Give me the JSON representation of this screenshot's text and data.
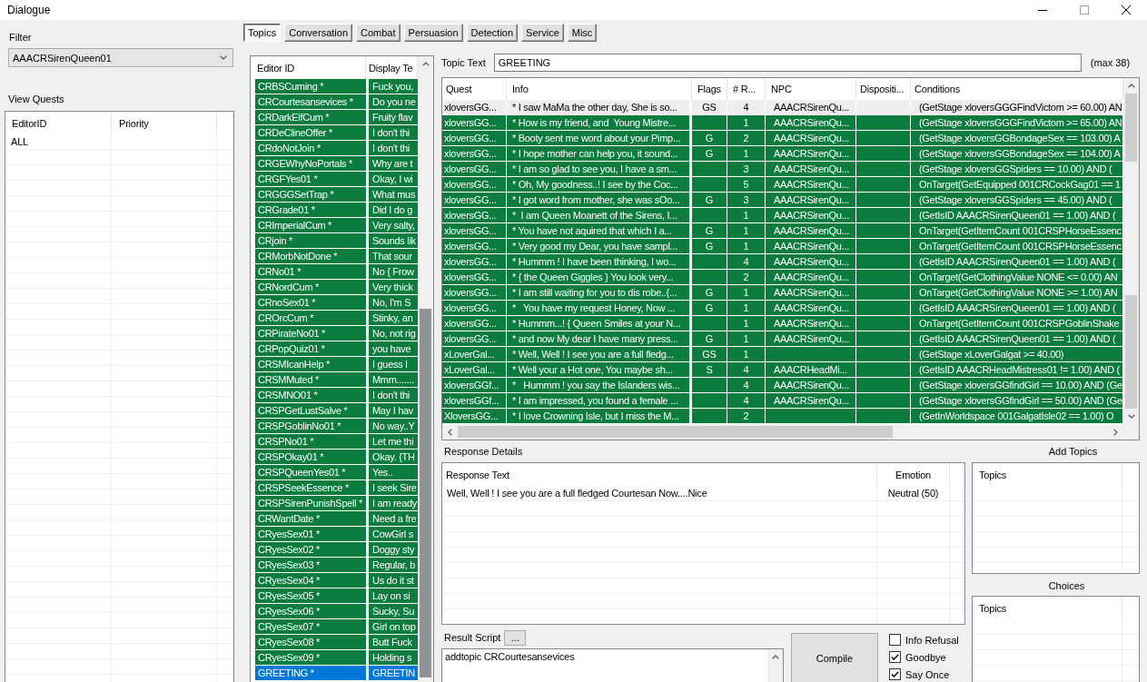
{
  "window": {
    "title": "Dialogue"
  },
  "filter": {
    "label": "Filter",
    "value": "AAACRSirenQueen01"
  },
  "quests": {
    "label": "View Quests",
    "columns": [
      "EditorID",
      "Priority"
    ],
    "rows": [
      {
        "editor_id": "ALL",
        "selected": false
      }
    ]
  },
  "tabs": [
    {
      "label": "Topics",
      "selected": true
    },
    {
      "label": "Conversation",
      "selected": false
    },
    {
      "label": "Combat",
      "selected": false
    },
    {
      "label": "Persuasion",
      "selected": false
    },
    {
      "label": "Detection",
      "selected": false
    },
    {
      "label": "Service",
      "selected": false
    },
    {
      "label": "Misc",
      "selected": false
    }
  ],
  "topics": {
    "columns": [
      "Editor ID",
      "Display Te"
    ],
    "rows": [
      {
        "editor_id": "CRBSCuming *",
        "column_2": "Fuck you,",
        "selected": false
      },
      {
        "editor_id": "CRCourtesansevices *",
        "column_2": "Do you ne",
        "selected": false
      },
      {
        "editor_id": "CRDarkElfCum *",
        "column_2": "Fruity flav",
        "selected": false
      },
      {
        "editor_id": "CRDeClineOffer *",
        "column_2": "I don't thi",
        "selected": false
      },
      {
        "editor_id": "CRdoNotJoin *",
        "column_2": "I don't thi",
        "selected": false
      },
      {
        "editor_id": "CRGEWhyNoPortals *",
        "column_2": "Why are t",
        "selected": false
      },
      {
        "editor_id": "CRGFYes01 *",
        "column_2": "Okay, I wi",
        "selected": false
      },
      {
        "editor_id": "CRGGGSetTrap *",
        "column_2": "What mus",
        "selected": false
      },
      {
        "editor_id": "CRGrade01 *",
        "column_2": "Did I do g",
        "selected": false
      },
      {
        "editor_id": "CRImperialCum *",
        "column_2": "Very salty,",
        "selected": false
      },
      {
        "editor_id": "CRjoin *",
        "column_2": "Sounds lik",
        "selected": false
      },
      {
        "editor_id": "CRMorbNotDone *",
        "column_2": "That sour",
        "selected": false
      },
      {
        "editor_id": "CRNo01 *",
        "column_2": "No { Frow",
        "selected": false
      },
      {
        "editor_id": "CRNordCum *",
        "column_2": "Very thick",
        "selected": false
      },
      {
        "editor_id": "CRnoSex01 *",
        "column_2": "No, I'm S",
        "selected": false
      },
      {
        "editor_id": "CROrcCum *",
        "column_2": "Stinky, an",
        "selected": false
      },
      {
        "editor_id": "CRPirateNo01 *",
        "column_2": "No, not rig",
        "selected": false
      },
      {
        "editor_id": "CRPopQuiz01 *",
        "column_2": "you have",
        "selected": false
      },
      {
        "editor_id": "CRSMIcanHelp *",
        "column_2": "I guess I",
        "selected": false
      },
      {
        "editor_id": "CRSMMuted *",
        "column_2": "Mmm.......",
        "selected": false
      },
      {
        "editor_id": "CRSMNO01 *",
        "column_2": "I don't thi",
        "selected": false
      },
      {
        "editor_id": "CRSPGetLustSalve *",
        "column_2": "May I hav",
        "selected": false
      },
      {
        "editor_id": "CRSPGoblinNo01 *",
        "column_2": "No way..Y",
        "selected": false
      },
      {
        "editor_id": "CRSPNo01 *",
        "column_2": "Let me thi",
        "selected": false
      },
      {
        "editor_id": "CRSPOkay01 *",
        "column_2": "Okay. {TH",
        "selected": false
      },
      {
        "editor_id": "CRSPQueenYes01 *",
        "column_2": "Yes..",
        "selected": false
      },
      {
        "editor_id": "CRSPSeekEssence *",
        "column_2": "I seek Sire",
        "selected": false
      },
      {
        "editor_id": "CRSPSirenPunishSpell *",
        "column_2": "I am ready",
        "selected": false
      },
      {
        "editor_id": "CRWantDate *",
        "column_2": "Need a fre",
        "selected": false
      },
      {
        "editor_id": "CRyesSex01 *",
        "column_2": "CowGirl s",
        "selected": false
      },
      {
        "editor_id": "CRyesSex02 *",
        "column_2": "Doggy sty",
        "selected": false
      },
      {
        "editor_id": "CRyesSex03 *",
        "column_2": "Regular, b",
        "selected": false
      },
      {
        "editor_id": "CRyesSex04 *",
        "column_2": "Us do it st",
        "selected": false
      },
      {
        "editor_id": "CRyesSex05 *",
        "column_2": "Lay on si",
        "selected": false
      },
      {
        "editor_id": "CRyesSex06 *",
        "column_2": "Sucky, Su",
        "selected": false
      },
      {
        "editor_id": "CRyesSex07 *",
        "column_2": "Girl on top",
        "selected": false
      },
      {
        "editor_id": "CRyesSex08 *",
        "column_2": "Butt Fuck",
        "selected": false
      },
      {
        "editor_id": "CRyesSex09 *",
        "column_2": "Holding s",
        "selected": false
      },
      {
        "editor_id": "GREETING *",
        "column_2": "GREETIN",
        "selected": true
      }
    ]
  },
  "topic_text": {
    "label": "Topic Text",
    "value": "GREETING",
    "limit": "(max 38)"
  },
  "infos": {
    "columns": [
      "Quest",
      "Info",
      "Flags",
      "# R...",
      "NPC",
      "Dispositi...",
      "Conditions"
    ],
    "rows": [
      {
        "quest": "xloversGG...",
        "info": "* I saw MaMa the other day, She is so...",
        "flags": "GS",
        "column_4": "4",
        "npc": "AAACRSirenQu...",
        "conditions": "(GetStage xloversGGGFindVictom >= 60.00) AN",
        "selected": true
      },
      {
        "quest": "xloversGG...",
        "info": "* How is my friend, and  Young Mistre...",
        "column_4": "1",
        "npc": "AAACRSirenQu...",
        "conditions": "(GetStage xloversGGGFindVictom >= 65.00) AN",
        "selected": false
      },
      {
        "quest": "xloversGG...",
        "info": "* Booty sent me word about your Pimp...",
        "flags": "G",
        "column_4": "2",
        "npc": "AAACRSirenQu...",
        "conditions": "(GetStage xloversGGBondageSex == 103.00) A",
        "selected": false
      },
      {
        "quest": "xloversGG...",
        "info": "* I hope mother can help you, it sound...",
        "flags": "G",
        "column_4": "1",
        "npc": "AAACRSirenQu...",
        "conditions": "(GetStage xloversGGBondageSex == 104.00) A",
        "selected": false
      },
      {
        "quest": "xloversGG...",
        "info": "* I am so glad to see you, I have a sm...",
        "column_4": "3",
        "npc": "AAACRSirenQu...",
        "conditions": "(GetStage xloversGGSpiders == 10.00) AND (",
        "selected": false
      },
      {
        "quest": "xloversGG...",
        "info": "* Oh, My goodness..! I see by the Coc...",
        "column_4": "5",
        "npc": "AAACRSirenQu...",
        "conditions": "OnTarget(GetEquipped 001CRCockGag01 == 1",
        "selected": false
      },
      {
        "quest": "xloversGG...",
        "info": "* I got word from mother, she was sOo...",
        "flags": "G",
        "column_4": "3",
        "npc": "AAACRSirenQu...",
        "conditions": "(GetStage xloversGGSpiders == 45.00) AND (",
        "selected": false
      },
      {
        "quest": "xloversGG...",
        "info": "*  I am Queen Moanett of the Sirens, I...",
        "column_4": "1",
        "npc": "AAACRSirenQu...",
        "conditions": "(GetIsID AAACRSirenQueen01 == 1.00) AND (",
        "selected": false
      },
      {
        "quest": "xloversGG...",
        "info": "* You have not aquired that which I a...",
        "flags": "G",
        "column_4": "1",
        "npc": "AAACRSirenQu...",
        "conditions": "OnTarget(GetItemCount 001CRSPHorseEssenc",
        "selected": false
      },
      {
        "quest": "xloversGG...",
        "info": "* Very good my Dear, you have sampl...",
        "flags": "G",
        "column_4": "1",
        "npc": "AAACRSirenQu...",
        "conditions": "OnTarget(GetItemCount 001CRSPHorseEssenc",
        "selected": false
      },
      {
        "quest": "xloversGG...",
        "info": "* Hummm ! I have been thinking, I wo...",
        "column_4": "4",
        "npc": "AAACRSirenQu...",
        "conditions": "(GetIsID AAACRSirenQueen01 == 1.00) AND (",
        "selected": false
      },
      {
        "quest": "xloversGG...",
        "info": "* { the Queen Giggles } You look very...",
        "column_4": "2",
        "npc": "AAACRSirenQu...",
        "conditions": "OnTarget(GetClothingValue NONE <= 0.00) AN",
        "selected": false
      },
      {
        "quest": "xloversGG...",
        "info": "* I am still waiting for you to dis robe..{...",
        "flags": "G",
        "column_4": "1",
        "npc": "AAACRSirenQu...",
        "conditions": "OnTarget(GetClothingValue NONE >= 1.00) AN",
        "selected": false
      },
      {
        "quest": "xloversGG...",
        "info": "*   You have my request Honey, Now ...",
        "flags": "G",
        "column_4": "1",
        "npc": "AAACRSirenQu...",
        "conditions": "(GetIsID AAACRSirenQueen01 == 1.00) AND (",
        "selected": false
      },
      {
        "quest": "xloversGG...",
        "info": "* Hummm...! { Queen Smiles at your N...",
        "column_4": "1",
        "npc": "AAACRSirenQu...",
        "conditions": "OnTarget(GetItemCount 001CRSPGoblinShake",
        "selected": false
      },
      {
        "quest": "xloversGG...",
        "info": "* and now My dear I have many press...",
        "flags": "G",
        "column_4": "1",
        "npc": "AAACRSirenQu...",
        "conditions": "(GetIsID AAACRSirenQueen01 == 1.00) AND (",
        "selected": false
      },
      {
        "quest": "xLoverGal...",
        "info": "* Well, Well ! I see you are a full fledg...",
        "flags": "GS",
        "column_4": "1",
        "conditions": "(GetStage xLoverGalgat >= 40.00)",
        "selected": false
      },
      {
        "quest": "xLoverGal...",
        "info": "* Well your a Hot one, You maybe sh...",
        "flags": "S",
        "column_4": "4",
        "npc": "AAACRHeadMi...",
        "conditions": "(GetIsID AAACRHeadMistress01 != 1.00) AND (",
        "selected": false
      },
      {
        "quest": "xloversGGf...",
        "info": "*   Hummm ! you say the Islanders wis...",
        "column_4": "4",
        "npc": "AAACRSirenQu...",
        "conditions": "(GetStage xloversGGfindGirl == 10.00) AND (Ge",
        "selected": false
      },
      {
        "quest": "xloversGGf...",
        "info": "* I am impressed, you found a female ...",
        "column_4": "4",
        "npc": "AAACRSirenQu...",
        "conditions": "(GetStage xloversGGfindGirl == 50.00) AND (Ge",
        "selected": false
      },
      {
        "quest": "XloversGG...",
        "info": "* I love Crowning Isle, but I miss the M...",
        "column_4": "2",
        "conditions": "(GetInWorldspace 001GalgatIsle02 == 1.00) O",
        "selected": false
      }
    ]
  },
  "response_details": {
    "label": "Response Details",
    "columns": [
      "Response Text",
      "Emotion"
    ],
    "rows": [
      {
        "text": "Well, Well ! I see you are a full fledged Courtesan Now....Nice",
        "emotion": "Neutral (50)",
        "selected": false
      }
    ]
  },
  "add_topics": {
    "label": "Add Topics",
    "columns": [
      "Topics"
    ]
  },
  "choices": {
    "label": "Choices",
    "columns": [
      "Topics"
    ]
  },
  "result_script": {
    "label": "Result Script",
    "button": "...",
    "value": "addtopic CRCourtesansevices"
  },
  "compile_button": "Compile",
  "options": [
    {
      "label": "Info Refusal",
      "checked": false
    },
    {
      "label": "Goodbye",
      "checked": true
    },
    {
      "label": "Say Once",
      "checked": true
    }
  ]
}
